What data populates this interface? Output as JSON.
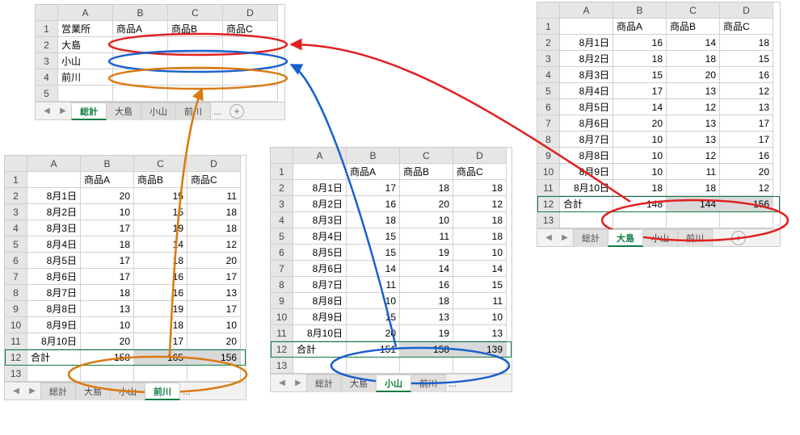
{
  "summary": {
    "tabs": {
      "nav_prev": "◀",
      "nav_next": "▶",
      "t0": "総計",
      "t1": "大島",
      "t2": "小山",
      "t3": "前川",
      "more": "...",
      "add": "+"
    },
    "cols": [
      "A",
      "B",
      "C",
      "D"
    ],
    "heads": {
      "a": "営業所",
      "b": "商品A",
      "c": "商品B",
      "d": "商品C"
    },
    "rows": {
      "r2": "大島",
      "r3": "小山",
      "r4": "前川"
    }
  },
  "oshima": {
    "tabs": {
      "t0": "総計",
      "t1": "大島",
      "t2": "小山",
      "t3": "前川",
      "more": "...",
      "add": "+",
      "nav_prev": "◀",
      "nav_next": "▶"
    },
    "cols": [
      "A",
      "B",
      "C",
      "D"
    ],
    "heads": {
      "b": "商品A",
      "c": "商品B",
      "d": "商品C"
    },
    "dates": {
      "d1": "8月1日",
      "d2": "8月2日",
      "d3": "8月3日",
      "d4": "8月4日",
      "d5": "8月5日",
      "d6": "8月6日",
      "d7": "8月7日",
      "d8": "8月8日",
      "d9": "8月9日",
      "d10": "8月10日"
    },
    "total_label": "合計",
    "data": {
      "r1": {
        "b": "16",
        "c": "14",
        "d": "18"
      },
      "r2": {
        "b": "18",
        "c": "18",
        "d": "15"
      },
      "r3": {
        "b": "15",
        "c": "20",
        "d": "16"
      },
      "r4": {
        "b": "17",
        "c": "13",
        "d": "12"
      },
      "r5": {
        "b": "14",
        "c": "12",
        "d": "13"
      },
      "r6": {
        "b": "20",
        "c": "13",
        "d": "17"
      },
      "r7": {
        "b": "10",
        "c": "13",
        "d": "17"
      },
      "r8": {
        "b": "10",
        "c": "12",
        "d": "16"
      },
      "r9": {
        "b": "10",
        "c": "11",
        "d": "20"
      },
      "r10": {
        "b": "18",
        "c": "18",
        "d": "12"
      }
    },
    "totals": {
      "b": "148",
      "c": "144",
      "d": "156"
    }
  },
  "koyama": {
    "tabs": {
      "t0": "総計",
      "t1": "大島",
      "t2": "小山",
      "t3": "前川",
      "more": "...",
      "add": "+",
      "nav_prev": "◀",
      "nav_next": "▶"
    },
    "cols": [
      "A",
      "B",
      "C",
      "D"
    ],
    "heads": {
      "b": "商品A",
      "c": "商品B",
      "d": "商品C"
    },
    "dates": {
      "d1": "8月1日",
      "d2": "8月2日",
      "d3": "8月3日",
      "d4": "8月4日",
      "d5": "8月5日",
      "d6": "8月6日",
      "d7": "8月7日",
      "d8": "8月8日",
      "d9": "8月9日",
      "d10": "8月10日"
    },
    "total_label": "合計",
    "data": {
      "r1": {
        "b": "17",
        "c": "18",
        "d": "18"
      },
      "r2": {
        "b": "16",
        "c": "20",
        "d": "12"
      },
      "r3": {
        "b": "18",
        "c": "10",
        "d": "18"
      },
      "r4": {
        "b": "15",
        "c": "11",
        "d": "18"
      },
      "r5": {
        "b": "15",
        "c": "19",
        "d": "10"
      },
      "r6": {
        "b": "14",
        "c": "14",
        "d": "14"
      },
      "r7": {
        "b": "11",
        "c": "16",
        "d": "15"
      },
      "r8": {
        "b": "10",
        "c": "18",
        "d": "11"
      },
      "r9": {
        "b": "15",
        "c": "13",
        "d": "10"
      },
      "r10": {
        "b": "20",
        "c": "19",
        "d": "13"
      }
    },
    "totals": {
      "b": "151",
      "c": "158",
      "d": "139"
    }
  },
  "maekawa": {
    "tabs": {
      "t0": "総計",
      "t1": "大島",
      "t2": "小山",
      "t3": "前川",
      "more": "...",
      "add": "+",
      "nav_prev": "◀",
      "nav_next": "▶"
    },
    "cols": [
      "A",
      "B",
      "C",
      "D"
    ],
    "heads": {
      "b": "商品A",
      "c": "商品B",
      "d": "商品C"
    },
    "dates": {
      "d1": "8月1日",
      "d2": "8月2日",
      "d3": "8月3日",
      "d4": "8月4日",
      "d5": "8月5日",
      "d6": "8月6日",
      "d7": "8月7日",
      "d8": "8月8日",
      "d9": "8月9日",
      "d10": "8月10日"
    },
    "total_label": "合計",
    "data": {
      "r1": {
        "b": "20",
        "c": "15",
        "d": "11"
      },
      "r2": {
        "b": "10",
        "c": "15",
        "d": "18"
      },
      "r3": {
        "b": "17",
        "c": "19",
        "d": "18"
      },
      "r4": {
        "b": "18",
        "c": "14",
        "d": "12"
      },
      "r5": {
        "b": "17",
        "c": "18",
        "d": "20"
      },
      "r6": {
        "b": "17",
        "c": "16",
        "d": "17"
      },
      "r7": {
        "b": "18",
        "c": "16",
        "d": "13"
      },
      "r8": {
        "b": "13",
        "c": "19",
        "d": "17"
      },
      "r9": {
        "b": "10",
        "c": "18",
        "d": "10"
      },
      "r10": {
        "b": "20",
        "c": "17",
        "d": "20"
      }
    },
    "totals": {
      "b": "158",
      "c": "165",
      "d": "156"
    }
  }
}
